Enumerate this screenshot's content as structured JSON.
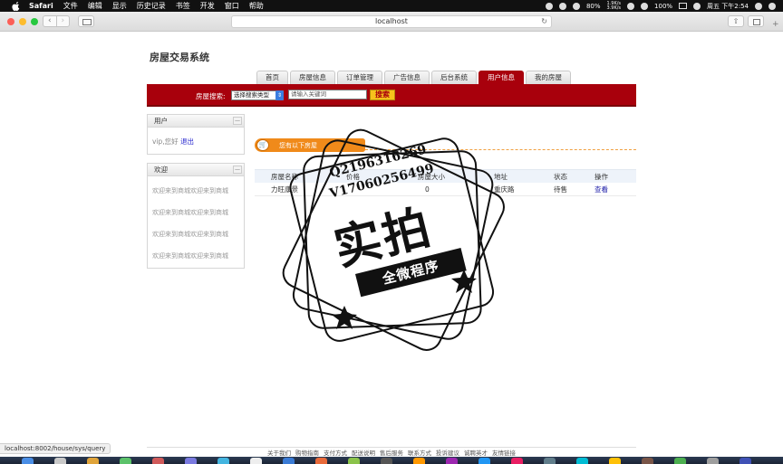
{
  "menubar": {
    "app": "Safari",
    "items": [
      "文件",
      "编辑",
      "显示",
      "历史记录",
      "书签",
      "开发",
      "窗口",
      "帮助"
    ],
    "net_up": "1.9K/s",
    "net_down": "3.9K/s",
    "battery_small": "80%",
    "battery": "100%",
    "clock": "周五 下午2:54"
  },
  "browser": {
    "url": "localhost",
    "status_url": "localhost:8002/house/sys/query"
  },
  "site": {
    "title": "房屋交易系统",
    "nav_tabs": [
      "首页",
      "房屋信息",
      "订单管理",
      "广告信息",
      "后台系统",
      "用户信息",
      "我的房屋"
    ],
    "active_tab": "用户信息"
  },
  "search": {
    "label": "房屋搜索:",
    "select_value": "选择搜索类型",
    "placeholder": "请输入关键词",
    "button": "搜索"
  },
  "user_panel": {
    "title": "用户",
    "greeting": "vip,您好",
    "logout": "退出",
    "min_label": "—"
  },
  "welcome_panel": {
    "title": "欢迎",
    "items": [
      "欢迎来到商城欢迎来到商城",
      "欢迎来到商城欢迎来到商城",
      "欢迎来到商城欢迎来到商城",
      "欢迎来到商城欢迎来到商城"
    ]
  },
  "listing": {
    "banner": "您有以下房屋",
    "columns": [
      "房屋名称",
      "价格",
      "房屋大小",
      "地址",
      "状态",
      "操作"
    ],
    "rows": [
      {
        "name": "力旺康景",
        "price": "",
        "size": "0",
        "address": "重庆路",
        "status": "待售",
        "action": "查看"
      }
    ]
  },
  "footer": {
    "links": [
      "关于我们",
      "购物指南",
      "支付方式",
      "配送说明",
      "售后服务",
      "联系方式",
      "投诉建议",
      "诚聘英才",
      "友情链接"
    ]
  },
  "watermark": {
    "line1": "Q2196316269",
    "line2": "V17060256499",
    "big": "实拍",
    "banner": "全微程序"
  },
  "colors": {
    "brand_red": "#a8000c",
    "search_button": "#f6c21c",
    "banner_orange": "#f08a1a"
  }
}
